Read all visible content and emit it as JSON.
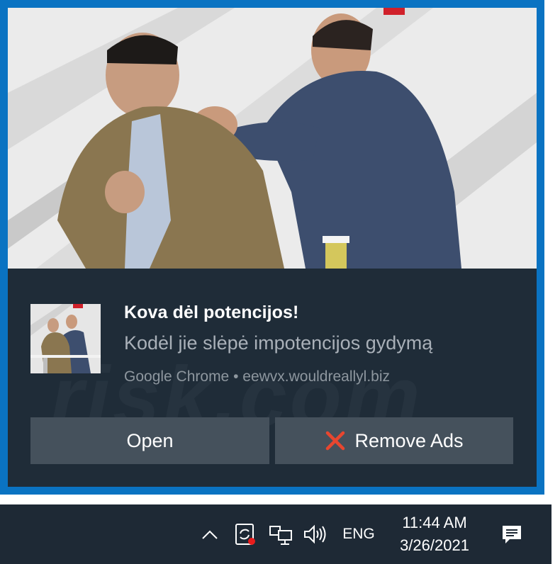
{
  "notification": {
    "title": "Kova dėl potencijos!",
    "body": "Kodėl jie slėpė impotencijos gydymą",
    "attribution": "Google Chrome • eewvx.wouldreallyl.biz",
    "actions": {
      "open_label": "Open",
      "remove_label": "Remove Ads"
    },
    "hero_image": "tv-studio-scuffle-photo",
    "thumbnail_image": "tv-studio-scuffle-thumbnail"
  },
  "taskbar": {
    "language": "ENG",
    "time": "11:44 AM",
    "date": "3/26/2021",
    "icons": [
      "chevron-up-icon",
      "sync-alert-icon",
      "network-icon",
      "volume-icon",
      "action-center-icon"
    ]
  },
  "colors": {
    "frame_blue": "#0a73c2",
    "toast_bg": "#1f2c38",
    "button_bg": "#45515c",
    "taskbar_bg": "#1e2935",
    "remove_x": "#e8462f"
  }
}
